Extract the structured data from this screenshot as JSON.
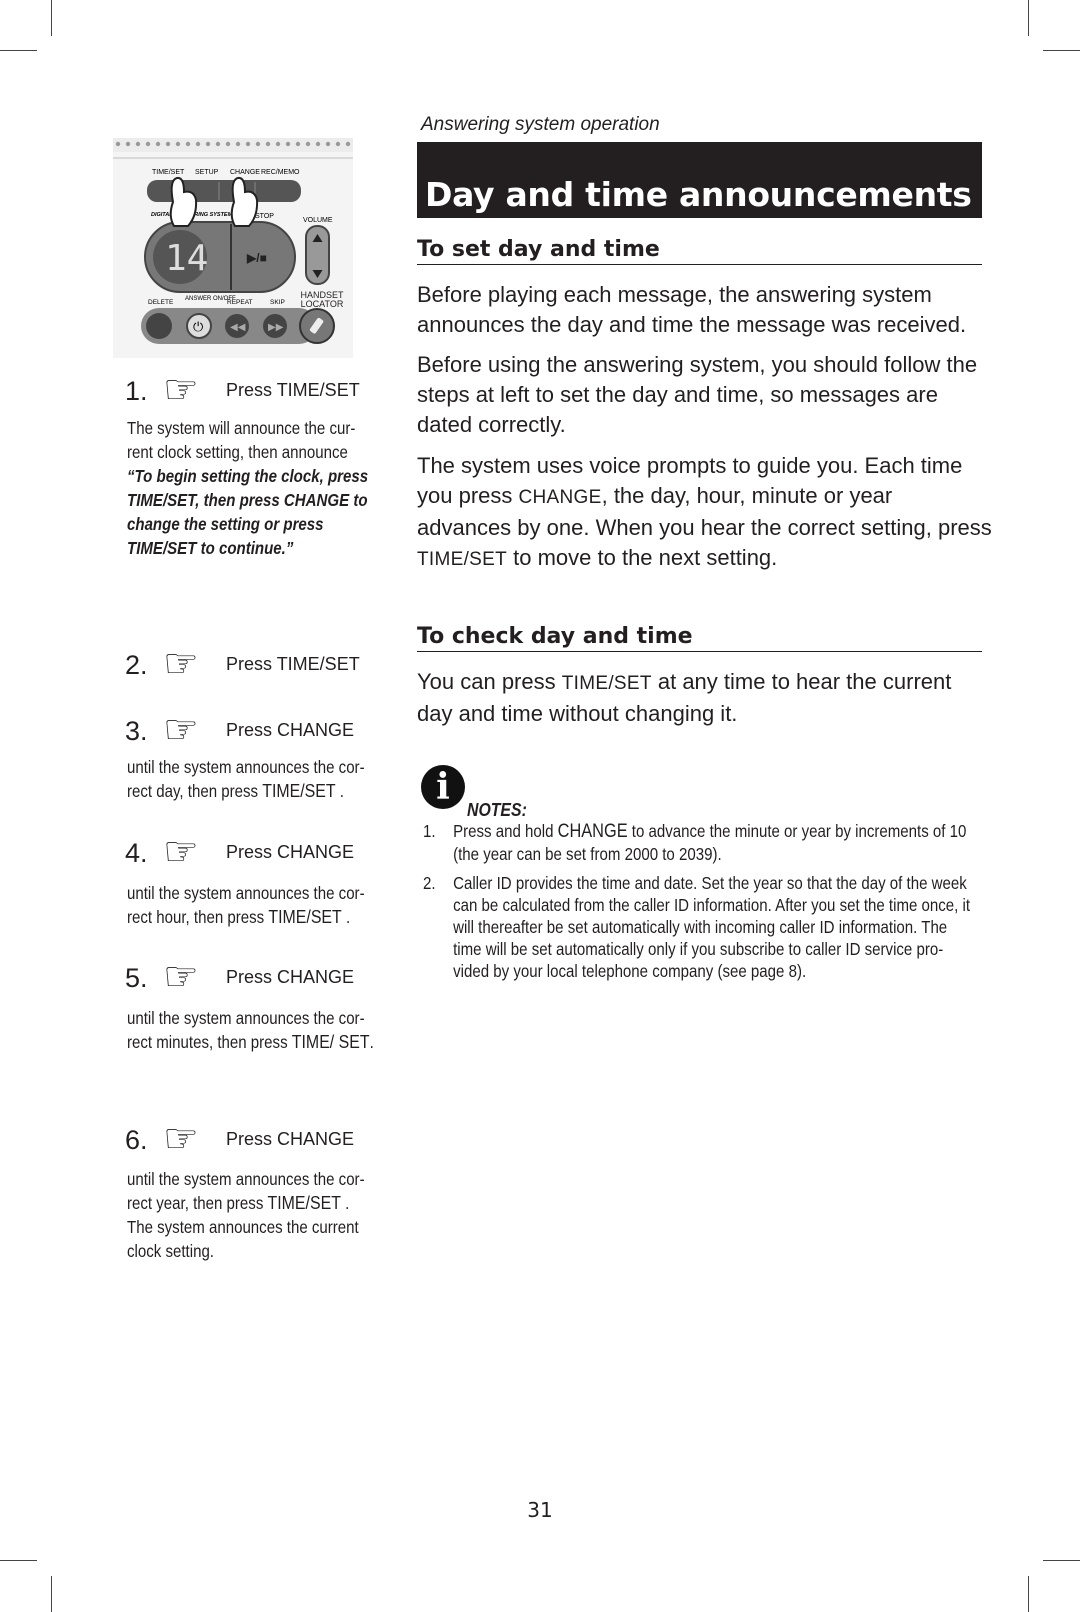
{
  "header": {
    "section": "Answering system operation",
    "title": "Day and time announcements"
  },
  "device": {
    "top_buttons": [
      "TIME/SET",
      "SETUP",
      "CHANGE",
      "REC/MEMO"
    ],
    "logo_text": "DIGITAL ANSWERING SYSTEM",
    "display": "14",
    "play_stop_label": "STOP",
    "play_stop_glyph": "▶/■",
    "volume_label": "VOLUME",
    "bottom_labels": [
      "DELETE",
      "ANSWER ON/OFF",
      "REPEAT",
      "SKIP",
      "HANDSET LOCATOR"
    ]
  },
  "steps": [
    {
      "num": "1.",
      "label_prefix": "Press ",
      "label_key": "TIME/SET",
      "desc": "The system will announce the cur- rent clock setting, then announce ",
      "quote": "“To begin setting the clock, press TIME/SET, then press CHANGE to change the setting or press TIME/SET to continue.”"
    },
    {
      "num": "2.",
      "label_prefix": "Press ",
      "label_key": "TIME/SET"
    },
    {
      "num": "3.",
      "label_prefix": "Press ",
      "label_key": "CHANGE",
      "desc": "until the system announces the cor- rect day,  then press ",
      "desc_key": "TIME/SET",
      "desc_end": " ."
    },
    {
      "num": "4.",
      "label_prefix": "Press ",
      "label_key": "CHANGE",
      "desc": "until the system announces the cor- rect hour,  then press ",
      "desc_key": "TIME/SET",
      "desc_end": " ."
    },
    {
      "num": "5.",
      "label_prefix": "Press ",
      "label_key": "CHANGE",
      "desc": "until the system announces the cor- rect minutes,  then press ",
      "desc_key": "TIME/ SET",
      "desc_end": "."
    },
    {
      "num": "6.",
      "label_prefix": "Press ",
      "label_key": "CHANGE",
      "desc": "until the system announces the cor- rect year,  then press ",
      "desc_key": "TIME/SET",
      "desc_end": " . The system announces the current clock setting."
    }
  ],
  "set_section": {
    "heading": "To set day and time",
    "p1": "Before playing each message, the answering system announces the day and time the message was received.",
    "p2": "Before using the answering system, you should follow the steps at left to set the day and time, so messages are dated correctly.",
    "p3_a": "The system uses voice prompts to guide you. Each time you press ",
    "p3_key1": "CHANGE",
    "p3_b": ", the day, hour, minute or year advances by one. When you hear the correct setting, press ",
    "p3_key2": "TIME/SET",
    "p3_c": "  to move to the next setting."
  },
  "check_section": {
    "heading": "To check day and time",
    "p_a": "You can press ",
    "p_key": "TIME/SET",
    "p_b": "  at any time to hear the current day and time without changing it."
  },
  "notes": {
    "icon": "info-icon",
    "title": "NOTES:",
    "items": [
      {
        "num": "1.",
        "a": "Press and hold ",
        "key": "CHANGE",
        "b": "  to advance the minute or year by increments of 10 (the year can be set from 2000 to 2039)."
      },
      {
        "num": "2.",
        "a": "Caller ID provides the time and date. Set the year so that the day of the week can be calculated from the caller ID information. After you set the time once, it will thereafter be set automatically with incoming caller ID information. The time will be set automatically only if you subscribe to caller ID service pro- vided by your local telephone company (see page 8)."
      }
    ]
  },
  "page_number": "31"
}
